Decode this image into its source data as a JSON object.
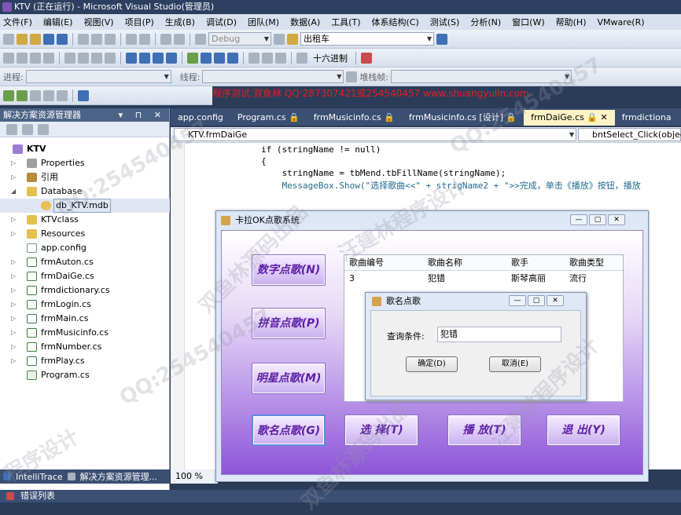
{
  "window": {
    "title": "KTV (正在运行) - Microsoft Visual Studio(管理员)"
  },
  "menu": [
    "文件(F)",
    "编辑(E)",
    "视图(V)",
    "项目(P)",
    "生成(B)",
    "调试(D)",
    "团队(M)",
    "数据(A)",
    "工具(T)",
    "体系结构(C)",
    "测试(S)",
    "分析(N)",
    "窗口(W)",
    "帮助(H)",
    "VMware(R)"
  ],
  "toolbar": {
    "config_combo": "Debug",
    "search_combo": "出租车",
    "hex_label": "十六进制",
    "process_label": "进程:",
    "thread_label": "线程:",
    "stackframe_label": "堆栈帧:"
  },
  "promo": "程序测试:双鱼林 QQ:287307421或254540457 www.shuangyulin.com",
  "solution_explorer": {
    "title": "解决方案资源管理器",
    "controls": "▾ ⊓ ✕",
    "items": [
      {
        "label": "KTV",
        "icon": "solution-icon"
      },
      {
        "label": "Properties",
        "icon": "properties-icon"
      },
      {
        "label": "引用",
        "icon": "references-icon"
      },
      {
        "label": "Database",
        "icon": "folder-icon"
      },
      {
        "label": "db_KTV.mdb",
        "icon": "database-icon"
      },
      {
        "label": "KTVclass",
        "icon": "folder-icon"
      },
      {
        "label": "Resources",
        "icon": "folder-icon"
      },
      {
        "label": "app.config",
        "icon": "config-file-icon"
      },
      {
        "label": "frmAuton.cs",
        "icon": "form-file-icon"
      },
      {
        "label": "frmDaiGe.cs",
        "icon": "form-file-icon"
      },
      {
        "label": "frmdictionary.cs",
        "icon": "form-file-icon"
      },
      {
        "label": "frmLogin.cs",
        "icon": "form-file-icon"
      },
      {
        "label": "frmMain.cs",
        "icon": "form-file-icon"
      },
      {
        "label": "frmMusicinfo.cs",
        "icon": "form-file-icon"
      },
      {
        "label": "frmNumber.cs",
        "icon": "form-file-icon"
      },
      {
        "label": "frmPlay.cs",
        "icon": "form-file-icon"
      },
      {
        "label": "Program.cs",
        "icon": "cs-file-icon"
      }
    ]
  },
  "bottom_tabs": [
    "IntelliTrace",
    "解决方案资源管理..."
  ],
  "error_list_tab": "错误列表",
  "doc_tabs": [
    "app.config",
    "Program.cs 🔒",
    "frmMusicinfo.cs 🔒",
    "frmMusicinfo.cs [设计] 🔒",
    "frmDaiGe.cs 🔒 ✕",
    "frmdictiona"
  ],
  "nav": {
    "class_combo": "KTV.frmDaiGe",
    "member_combo": "bntSelect_Click(object"
  },
  "code_lines": [
    "if (stringName != null)",
    "{",
    "    stringName = tbMend.tbFillName(stringName);",
    "    MessageBox.Show(\"选择歌曲<<\" + strigName2 + \">>完成，单击《播放》按钮，播放"
  ],
  "zoom": "100 %",
  "app": {
    "title": "卡拉OK点歌系统",
    "controls": [
      "—",
      "▢",
      "✕"
    ],
    "buttons": {
      "number": "数字点歌(N)",
      "pinyin": "拼音点歌(P)",
      "star": "明星点歌(M)",
      "songname": "歌名点歌(G)",
      "select": "选 择(T)",
      "play": "播 放(T)",
      "exit": "退 出(Y)"
    },
    "table": {
      "headers": [
        "歌曲编号",
        "歌曲名称",
        "歌手",
        "歌曲类型"
      ],
      "rows": [
        [
          "3",
          "犯错",
          "斯琴高丽",
          "流行"
        ]
      ]
    }
  },
  "dialog": {
    "title": "歌名点歌",
    "controls": [
      "—",
      "▢",
      "✕"
    ],
    "query_label": "查询条件:",
    "query_value": "犯错",
    "ok_label": "确定(D)",
    "cancel_label": "取消(E)"
  },
  "watermarks": [
    "QQ:254540457",
    "双鱼林源码出品",
    "汪建林程序设计",
    "QQ:254540457",
    "双鱼林源码出品",
    "汪建林程序设计",
    "QQ:254540457",
    "程序设计"
  ]
}
